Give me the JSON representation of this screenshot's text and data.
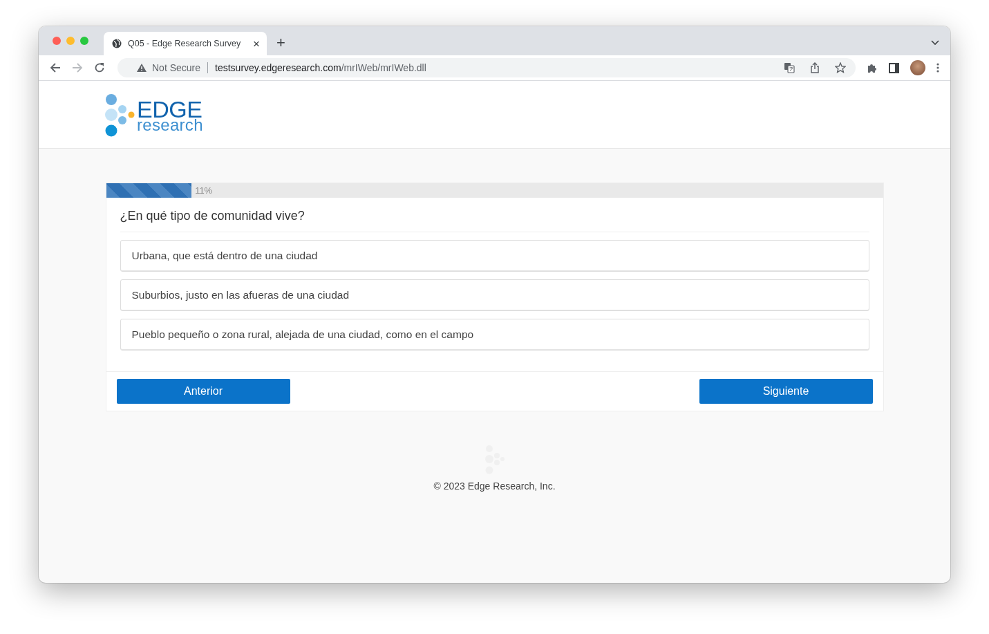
{
  "browser": {
    "tab": {
      "title": "Q05 - Edge Research Survey",
      "close": "×"
    },
    "new_tab": "+",
    "security": "Not Secure",
    "url_host": "testsurvey.edgeresearch.com",
    "url_path": "/mrIWeb/mrIWeb.dll"
  },
  "logo": {
    "word": "EDGE",
    "sub": "research"
  },
  "progress": {
    "level": 0.11,
    "reading": "11%"
  },
  "question": "¿En qué tipo de comunidad vive?",
  "answers": [
    {
      "label": "Urbana, que está dentro de una ciudad",
      "selected": false
    },
    {
      "label": "Suburbios, justo en las afueras de una ciudad",
      "selected": false
    },
    {
      "label": "Pueblo pequeño o zona rural, alejada de una ciudad, como en el campo",
      "selected": false
    }
  ],
  "buttons": {
    "previous": "Anterior",
    "next": "Siguiente"
  },
  "footer": "© 2023 Edge Research, Inc."
}
